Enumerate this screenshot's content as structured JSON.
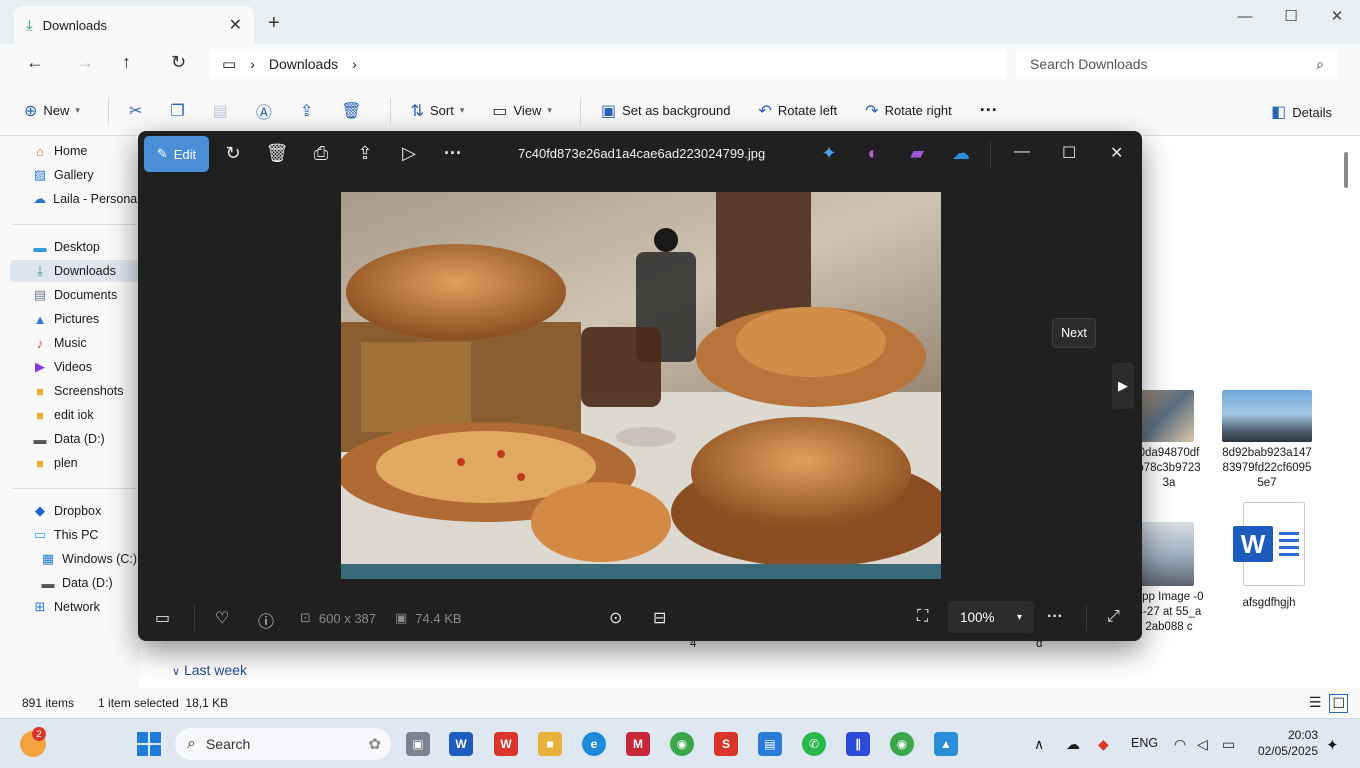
{
  "explorer": {
    "tab_title": "Downloads",
    "breadcrumb": [
      "Downloads"
    ],
    "search_placeholder": "Search Downloads",
    "toolbar": {
      "new_label": "New",
      "sort_label": "Sort",
      "view_label": "View",
      "set_background_label": "Set as background",
      "rotate_left_label": "Rotate left",
      "rotate_right_label": "Rotate right",
      "details_label": "Details"
    },
    "sidebar": [
      {
        "label": "Home",
        "icon": "home-icon"
      },
      {
        "label": "Gallery",
        "icon": "gallery-icon"
      },
      {
        "label": "Laila - Personal",
        "icon": "onedrive-icon"
      },
      {
        "label": "Desktop",
        "icon": "desktop-icon"
      },
      {
        "label": "Downloads",
        "icon": "download-icon"
      },
      {
        "label": "Documents",
        "icon": "documents-icon"
      },
      {
        "label": "Pictures",
        "icon": "pictures-icon"
      },
      {
        "label": "Music",
        "icon": "music-icon"
      },
      {
        "label": "Videos",
        "icon": "videos-icon"
      },
      {
        "label": "Screenshots",
        "icon": "folder-icon"
      },
      {
        "label": "edit iok",
        "icon": "folder-icon"
      },
      {
        "label": "Data (D:)",
        "icon": "drive-icon"
      },
      {
        "label": "plen",
        "icon": "folder-icon"
      },
      {
        "label": "Dropbox",
        "icon": "dropbox-icon"
      },
      {
        "label": "This PC",
        "icon": "pc-icon"
      },
      {
        "label": "Windows (C:)",
        "icon": "drive-icon"
      },
      {
        "label": "Data (D:)",
        "icon": "drive-icon"
      },
      {
        "label": "Network",
        "icon": "network-icon"
      }
    ],
    "files": [
      {
        "name": "0da94870df b78c3b9723 3a"
      },
      {
        "name": "8d92bab923a147 83979fd22cf6095 5e7"
      },
      {
        "name": "App Image -04-27 at 55_a2ab088 c"
      },
      {
        "name": "afsgdfhgjh"
      }
    ],
    "partial_labels": [
      "4",
      "d"
    ],
    "section_last_week": "Last week",
    "status": {
      "items": "891 items",
      "selected": "1 item selected  18,1 KB"
    }
  },
  "photos": {
    "edit_label": "Edit",
    "filename": "7c40fd873e26ad1a4cae6ad223024799.jpg",
    "next_tooltip": "Next",
    "dimensions": "600 x 387",
    "filesize": "74.4 KB",
    "zoom": "100%"
  },
  "taskbar": {
    "search_label": "Search",
    "weather_badge": "2",
    "language": "ENG",
    "time": "20:03",
    "date": "02/05/2025"
  },
  "colors": {
    "accent": "#4a8ed8",
    "photos_bg": "#202020",
    "explorer_bg": "#f9f9f9"
  }
}
